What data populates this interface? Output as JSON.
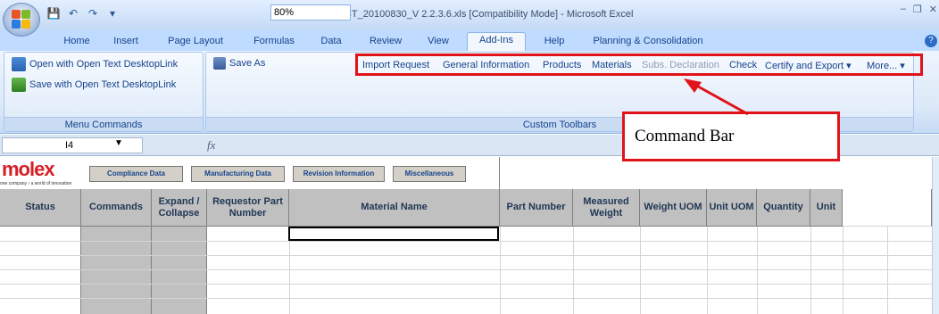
{
  "title_bar": {
    "title": "Molex_DCT_20100830_V 2.2.3.6.xls  [Compatibility Mode]  -  Microsoft Excel",
    "qat_icons": [
      "save-icon",
      "undo-icon",
      "redo-icon",
      "customize-icon"
    ]
  },
  "tabs": [
    {
      "label": "Home"
    },
    {
      "label": "Insert"
    },
    {
      "label": "Page Layout"
    },
    {
      "label": "Formulas"
    },
    {
      "label": "Data"
    },
    {
      "label": "Review"
    },
    {
      "label": "View"
    },
    {
      "label": "Add-Ins",
      "active": true
    },
    {
      "label": "Help"
    },
    {
      "label": "Planning & Consolidation"
    }
  ],
  "ribbon": {
    "menu_commands": {
      "open_label": "Open with Open Text DesktopLink",
      "save_label": "Save with Open Text DesktopLink",
      "group_label": "Menu Commands"
    },
    "custom_toolbars": {
      "save_as_label": "Save As",
      "zoom_value": "80%",
      "group_label": "Custom Toolbars",
      "commands": [
        {
          "label": "Import Request",
          "enabled": true
        },
        {
          "label": "General Information",
          "enabled": true
        },
        {
          "label": "Products",
          "enabled": true
        },
        {
          "label": "Materials",
          "enabled": true
        },
        {
          "label": "Subs. Declaration",
          "enabled": false
        },
        {
          "label": "Check",
          "enabled": true
        },
        {
          "label": "Certify and Export ▾",
          "enabled": true
        },
        {
          "label": "More... ▾",
          "enabled": true
        }
      ]
    }
  },
  "callout": {
    "text": "Command Bar"
  },
  "formula_bar": {
    "name_box": "I4",
    "fx": "fx",
    "formula": ""
  },
  "sheet": {
    "logo": "molex",
    "tagline": "one company › a world of innovation",
    "buttons": [
      "Compliance Data",
      "Manufacturing Data",
      "Revision Information",
      "Miscellaneous"
    ],
    "headers": [
      "Status",
      "Commands",
      "Expand / Collapse",
      "Requestor Part Number",
      "Material Name",
      "Part Number",
      "Measured Weight",
      "Weight UOM",
      "Unit UOM",
      "Quantity",
      "Unit"
    ]
  },
  "colors": {
    "highlight": "#e1131a",
    "header_bg": "#c0c0c0",
    "status_fill": "#c0c0c0",
    "ribbon_text": "#15428b"
  }
}
